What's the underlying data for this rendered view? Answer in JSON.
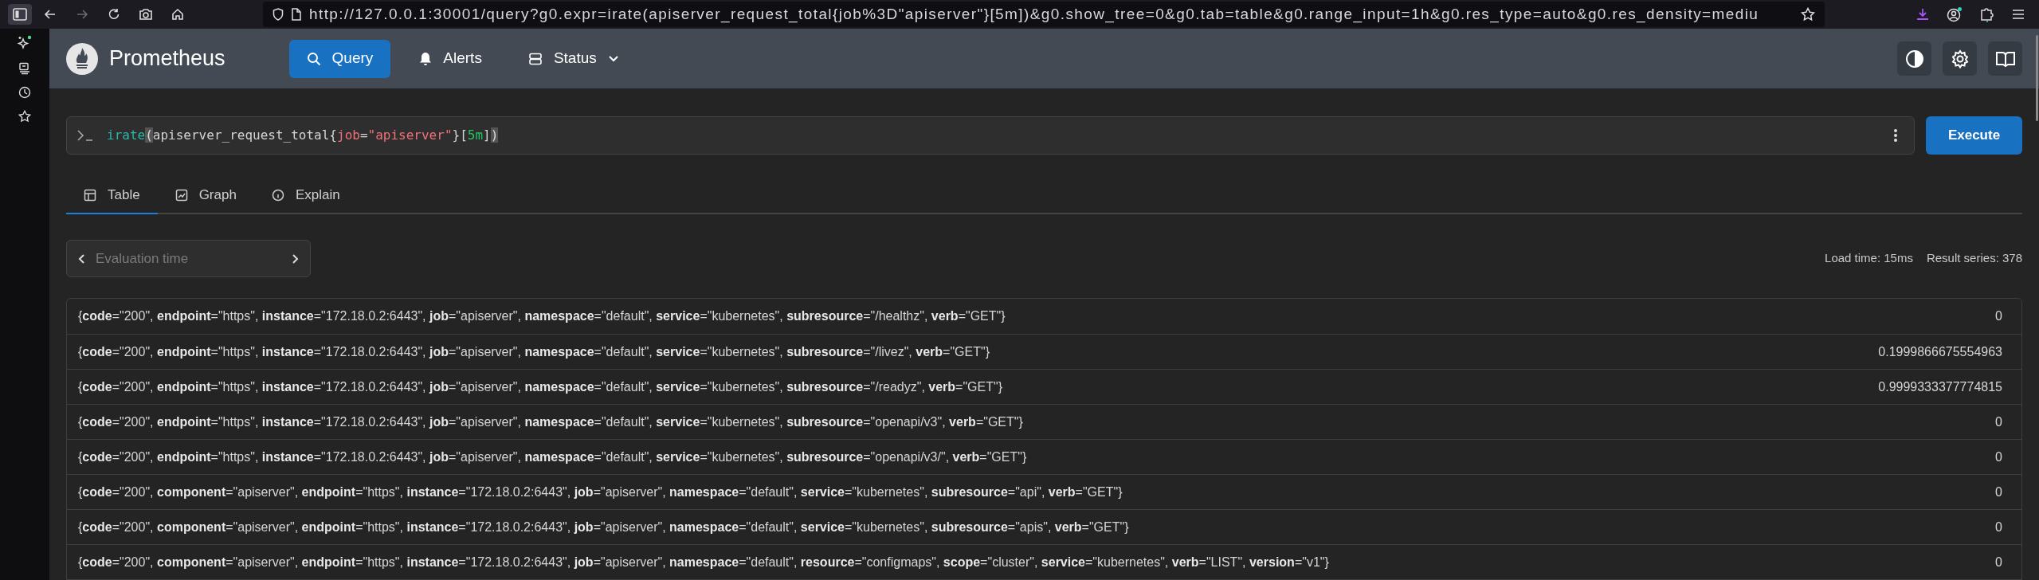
{
  "browser": {
    "url": "http://127.0.0.1:30001/query?g0.expr=irate(apiserver_request_total{job%3D\"apiserver\"}[5m])&g0.show_tree=0&g0.tab=table&g0.range_input=1h&g0.res_type=auto&g0.res_density=mediu",
    "forward_disabled": true
  },
  "header": {
    "title": "Prometheus",
    "nav": [
      {
        "label": "Query",
        "selected": true,
        "kind": "query"
      },
      {
        "label": "Alerts",
        "selected": false,
        "kind": "alerts"
      },
      {
        "label": "Status",
        "selected": false,
        "kind": "status"
      }
    ]
  },
  "query": {
    "tokens": [
      {
        "text": "irate",
        "kind": "function"
      },
      {
        "text": "(",
        "kind": "match"
      },
      {
        "text": "apiserver_request_total{",
        "kind": "plain"
      },
      {
        "text": "job",
        "kind": "label"
      },
      {
        "text": "=",
        "kind": "plain"
      },
      {
        "text": "\"apiserver\"",
        "kind": "string"
      },
      {
        "text": "}[",
        "kind": "plain"
      },
      {
        "text": "5m",
        "kind": "number"
      },
      {
        "text": "]",
        "kind": "plain"
      },
      {
        "text": ")",
        "kind": "match"
      }
    ],
    "execute": "Execute"
  },
  "tabs": [
    {
      "label": "Table",
      "selected": true,
      "kind": "table"
    },
    {
      "label": "Graph",
      "selected": false,
      "kind": "graph"
    },
    {
      "label": "Explain",
      "selected": false,
      "kind": "explain"
    }
  ],
  "evaluation_time": {
    "placeholder": "Evaluation time"
  },
  "stats": [
    "Load time: 15ms",
    "Result series: 378"
  ],
  "rows": [
    {
      "series": "{**code**=\"200\", **endpoint**=\"https\", **instance**=\"172.18.0.2:6443\", **job**=\"apiserver\", **namespace**=\"default\", **service**=\"kubernetes\", **subresource**=\"/healthz\", **verb**=\"GET\"}",
      "value": "0"
    },
    {
      "series": "{**code**=\"200\", **endpoint**=\"https\", **instance**=\"172.18.0.2:6443\", **job**=\"apiserver\", **namespace**=\"default\", **service**=\"kubernetes\", **subresource**=\"/livez\", **verb**=\"GET\"}",
      "value": "0.1999866675554963"
    },
    {
      "series": "{**code**=\"200\", **endpoint**=\"https\", **instance**=\"172.18.0.2:6443\", **job**=\"apiserver\", **namespace**=\"default\", **service**=\"kubernetes\", **subresource**=\"/readyz\", **verb**=\"GET\"}",
      "value": "0.9999333377774815"
    },
    {
      "series": "{**code**=\"200\", **endpoint**=\"https\", **instance**=\"172.18.0.2:6443\", **job**=\"apiserver\", **namespace**=\"default\", **service**=\"kubernetes\", **subresource**=\"openapi/v3\", **verb**=\"GET\"}",
      "value": "0"
    },
    {
      "series": "{**code**=\"200\", **endpoint**=\"https\", **instance**=\"172.18.0.2:6443\", **job**=\"apiserver\", **namespace**=\"default\", **service**=\"kubernetes\", **subresource**=\"openapi/v3/\", **verb**=\"GET\"}",
      "value": "0"
    },
    {
      "series": "{**code**=\"200\", **component**=\"apiserver\", **endpoint**=\"https\", **instance**=\"172.18.0.2:6443\", **job**=\"apiserver\", **namespace**=\"default\", **service**=\"kubernetes\", **subresource**=\"api\", **verb**=\"GET\"}",
      "value": "0"
    },
    {
      "series": "{**code**=\"200\", **component**=\"apiserver\", **endpoint**=\"https\", **instance**=\"172.18.0.2:6443\", **job**=\"apiserver\", **namespace**=\"default\", **service**=\"kubernetes\", **subresource**=\"apis\", **verb**=\"GET\"}",
      "value": "0"
    },
    {
      "series": "{**code**=\"200\", **component**=\"apiserver\", **endpoint**=\"https\", **instance**=\"172.18.0.2:6443\", **job**=\"apiserver\", **namespace**=\"default\", **resource**=\"configmaps\", **scope**=\"cluster\", **service**=\"kubernetes\", **verb**=\"LIST\", **version**=\"v1\"}",
      "value": "0"
    }
  ]
}
